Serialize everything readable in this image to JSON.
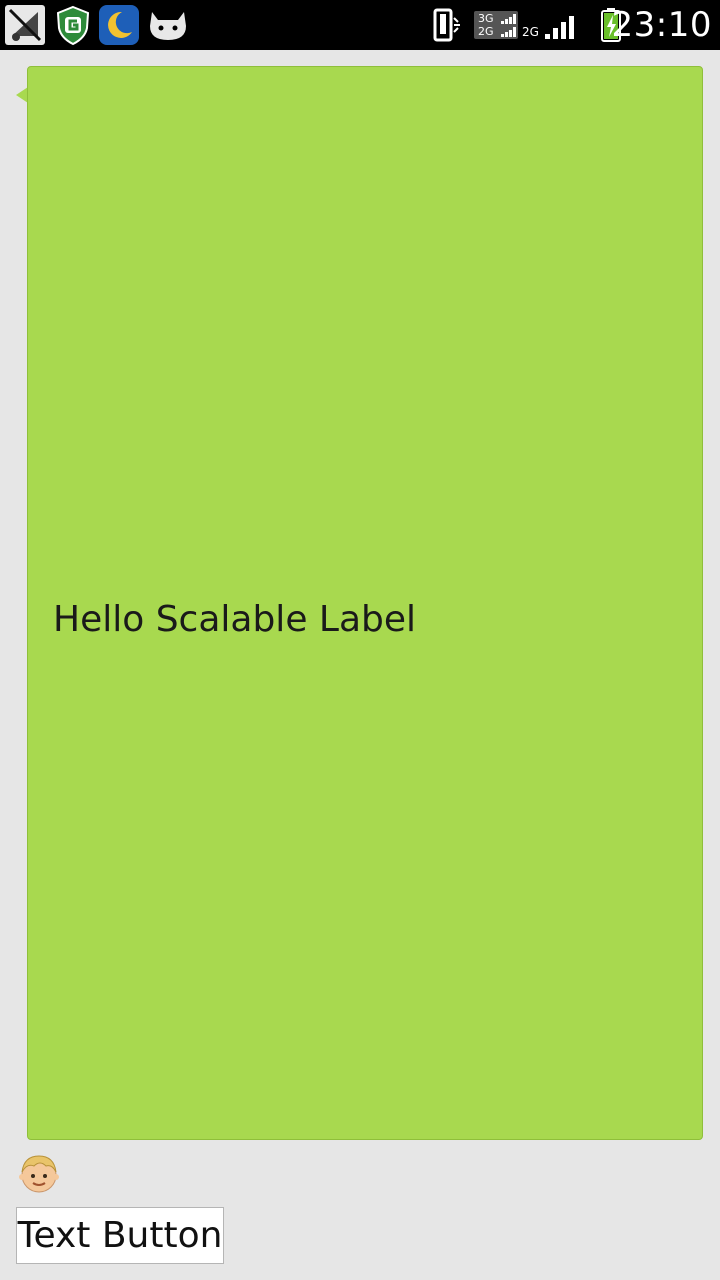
{
  "status_bar": {
    "time": "23:10",
    "network_top": "3G",
    "network_bottom": "2G",
    "network_small": "2G",
    "icons": [
      "app-icon-no-signal",
      "shield-icon",
      "moon-icon",
      "android-cat-icon",
      "phone-vibrate-icon",
      "signal-bars-icon",
      "battery-charging-icon"
    ]
  },
  "bubble": {
    "label": "Hello Scalable Label",
    "color": "#a8d94f"
  },
  "avatar": {
    "icon": "boy-face-icon"
  },
  "button": {
    "label": "Text Button"
  }
}
